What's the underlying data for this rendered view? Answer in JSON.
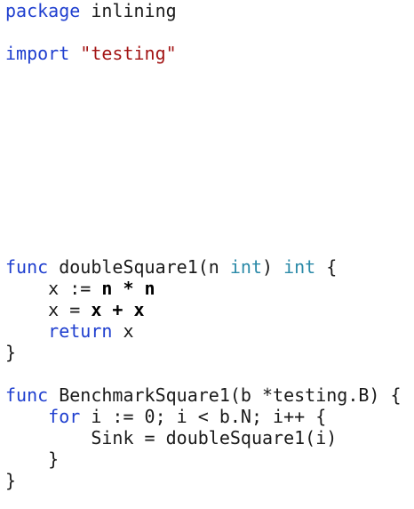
{
  "code": {
    "pkg_kw": "package",
    "pkg_name": " inlining",
    "import_kw": "import",
    "import_path": "\"testing\"",
    "func1_kw": "func",
    "func1_sig_a": " doubleSquare1(n ",
    "func1_param_type": "int",
    "func1_sig_b": ") ",
    "func1_ret_type": "int",
    "func1_sig_c": " {",
    "l1_indent": "    x := ",
    "l1_a": "n",
    "l1_op": " * ",
    "l1_b": "n",
    "l2_indent": "    x = ",
    "l2_a": "x",
    "l2_op": " + ",
    "l2_b": "x",
    "l3_indent": "    ",
    "l3_kw": "return",
    "l3_rest": " x",
    "close1": "}",
    "func2_kw": "func",
    "func2_sig": " BenchmarkSquare1(b *testing.B) {",
    "for_indent": "    ",
    "for_kw": "for",
    "for_rest": " i := 0; i < b.N; i++ {",
    "body_line": "        Sink = doubleSquare1(i)",
    "close_for": "    }",
    "close2": "}"
  }
}
